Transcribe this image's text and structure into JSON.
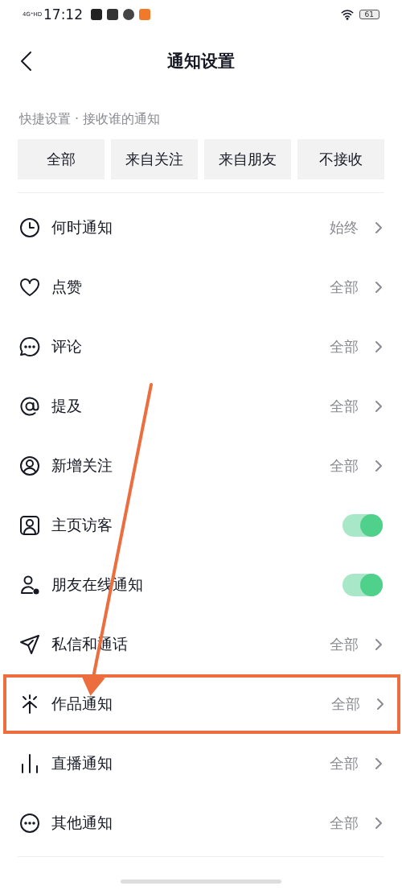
{
  "status_bar": {
    "network": "4G⁺HD",
    "time": "17:12",
    "battery": "61"
  },
  "header": {
    "title": "通知设置"
  },
  "quick_settings": {
    "label": "快捷设置 · 接收谁的通知",
    "options": [
      {
        "label": "全部",
        "selected": false
      },
      {
        "label": "来自关注",
        "selected": false
      },
      {
        "label": "来自朋友",
        "selected": false
      },
      {
        "label": "不接收",
        "selected": false
      }
    ]
  },
  "settings": [
    {
      "kind": "value",
      "label": "何时通知",
      "value": "始终",
      "highlighted": false
    },
    {
      "kind": "value",
      "label": "点赞",
      "value": "全部",
      "highlighted": false
    },
    {
      "kind": "value",
      "label": "评论",
      "value": "全部",
      "highlighted": false
    },
    {
      "kind": "value",
      "label": "提及",
      "value": "全部",
      "highlighted": false
    },
    {
      "kind": "value",
      "label": "新增关注",
      "value": "全部",
      "highlighted": false
    },
    {
      "kind": "toggle",
      "label": "主页访客",
      "on": true,
      "highlighted": false
    },
    {
      "kind": "toggle",
      "label": "朋友在线通知",
      "on": true,
      "highlighted": false
    },
    {
      "kind": "value",
      "label": "私信和通话",
      "value": "全部",
      "highlighted": false
    },
    {
      "kind": "value",
      "label": "作品通知",
      "value": "全部",
      "highlighted": true
    },
    {
      "kind": "value",
      "label": "直播通知",
      "value": "全部",
      "highlighted": false
    },
    {
      "kind": "value",
      "label": "其他通知",
      "value": "全部",
      "highlighted": false
    }
  ]
}
